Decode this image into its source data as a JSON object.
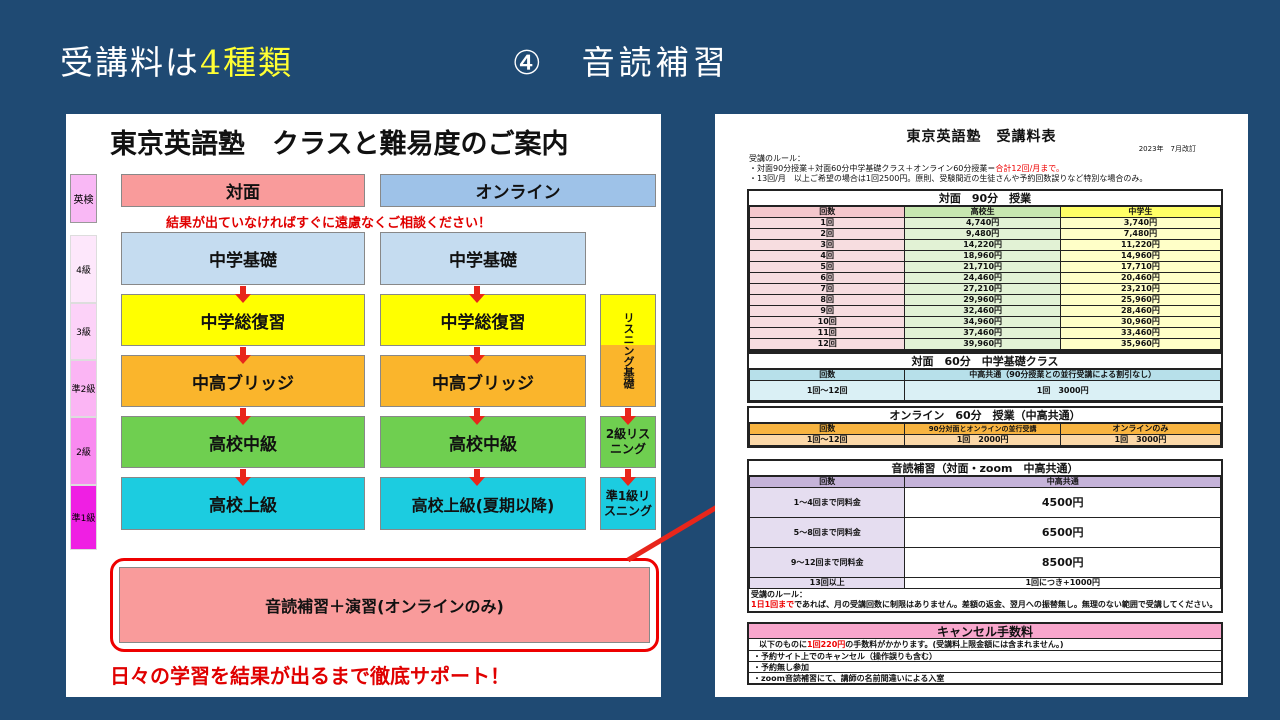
{
  "slide": {
    "title_prefix": "受講料は",
    "title_highlight": "4種類",
    "section_num": "④",
    "section_title": "音読補習"
  },
  "left": {
    "title": "東京英語塾　クラスと難易度のご案内",
    "level_header": "英検",
    "levels": [
      "4級",
      "3級",
      "準2級",
      "2級",
      "準1級"
    ],
    "col_offline": "対面",
    "col_online": "オンライン",
    "notice": "結果が出ていなければすぐに遠慮なくご相談ください！",
    "offline_courses": [
      "中学基礎",
      "中学総復習",
      "中高ブリッジ",
      "高校中級",
      "高校上級"
    ],
    "online_courses": [
      "中学基礎",
      "中学総復習",
      "中高ブリッジ",
      "高校中級",
      "高校上級(夏期以降)"
    ],
    "listening": [
      "リスニング基礎",
      "2級リスニング",
      "準1級リスニング"
    ],
    "ondoku_box": "音読補習＋演習(オンラインのみ)",
    "support": "日々の学習を結果が出るまで徹底サポート！"
  },
  "right": {
    "title": "東京英語塾　受講料表",
    "date": "2023年　7月改訂",
    "rules_head": "受講のルール：",
    "rules_1a": "・対面90分授業＋対面60分中学基礎クラス＋オンライン60分授業＝",
    "rules_1b": "合計12回/月まで。",
    "rules_2": "・13回/月　以上ご希望の場合は1回2500円。原則、受験間近の生徒さんや予約回数誤りなど特別な場合のみ。",
    "t1": {
      "title": "対面　90分　授業",
      "headers": [
        "回数",
        "高校生",
        "中学生"
      ],
      "rows": [
        [
          "1回",
          "4,740円",
          "3,740円"
        ],
        [
          "2回",
          "9,480円",
          "7,480円"
        ],
        [
          "3回",
          "14,220円",
          "11,220円"
        ],
        [
          "4回",
          "18,960円",
          "14,960円"
        ],
        [
          "5回",
          "21,710円",
          "17,710円"
        ],
        [
          "6回",
          "24,460円",
          "20,460円"
        ],
        [
          "7回",
          "27,210円",
          "23,210円"
        ],
        [
          "8回",
          "29,960円",
          "25,960円"
        ],
        [
          "9回",
          "32,460円",
          "28,460円"
        ],
        [
          "10回",
          "34,960円",
          "30,960円"
        ],
        [
          "11回",
          "37,460円",
          "33,460円"
        ],
        [
          "12回",
          "39,960円",
          "35,960円"
        ]
      ]
    },
    "t2": {
      "title": "対面　60分　中学基礎クラス",
      "headers": [
        "回数",
        "中高共通（90分授業との並行受講による割引なし）"
      ],
      "row": [
        "1回～12回",
        "1回　3000円"
      ]
    },
    "t3": {
      "title": "オンライン　60分　授業（中高共通）",
      "headers": [
        "回数",
        "90分対面とオンラインの並行受講",
        "オンラインのみ"
      ],
      "row": [
        "1回～12回",
        "1回　2000円",
        "1回　3000円"
      ]
    },
    "t4": {
      "title": "音読補習（対面・zoom　中高共通）",
      "headers": [
        "回数",
        "中高共通"
      ],
      "rows": [
        [
          "1～4回まで同料金",
          "4500円"
        ],
        [
          "5～8回まで同料金",
          "6500円"
        ],
        [
          "9～12回まで同料金",
          "8500円"
        ],
        [
          "13回以上",
          "1回につき+1000円"
        ]
      ],
      "rules_head": "受講のルール：",
      "rules_red": "1日1回まで",
      "rules_body": "であれば、月の受講回数に制限はありません。差額の返金、翌月への振替無し。無理のない範囲で受講してください。"
    },
    "t5": {
      "title": "キャンセル手数料",
      "intro_a": "以下のものに",
      "intro_red": "1回220円",
      "intro_b": "の手数料がかかります。(受講料上限金額には含まれません。)",
      "items": [
        "・予約サイト上でのキャンセル（操作誤りも含む）",
        "・予約無し参加",
        "・zoom音読補習にて、講師の名前間違いによる入室"
      ]
    }
  },
  "colors": {
    "background": "#1f4a73",
    "highlight": "#ffff33",
    "red": "#e00000"
  }
}
